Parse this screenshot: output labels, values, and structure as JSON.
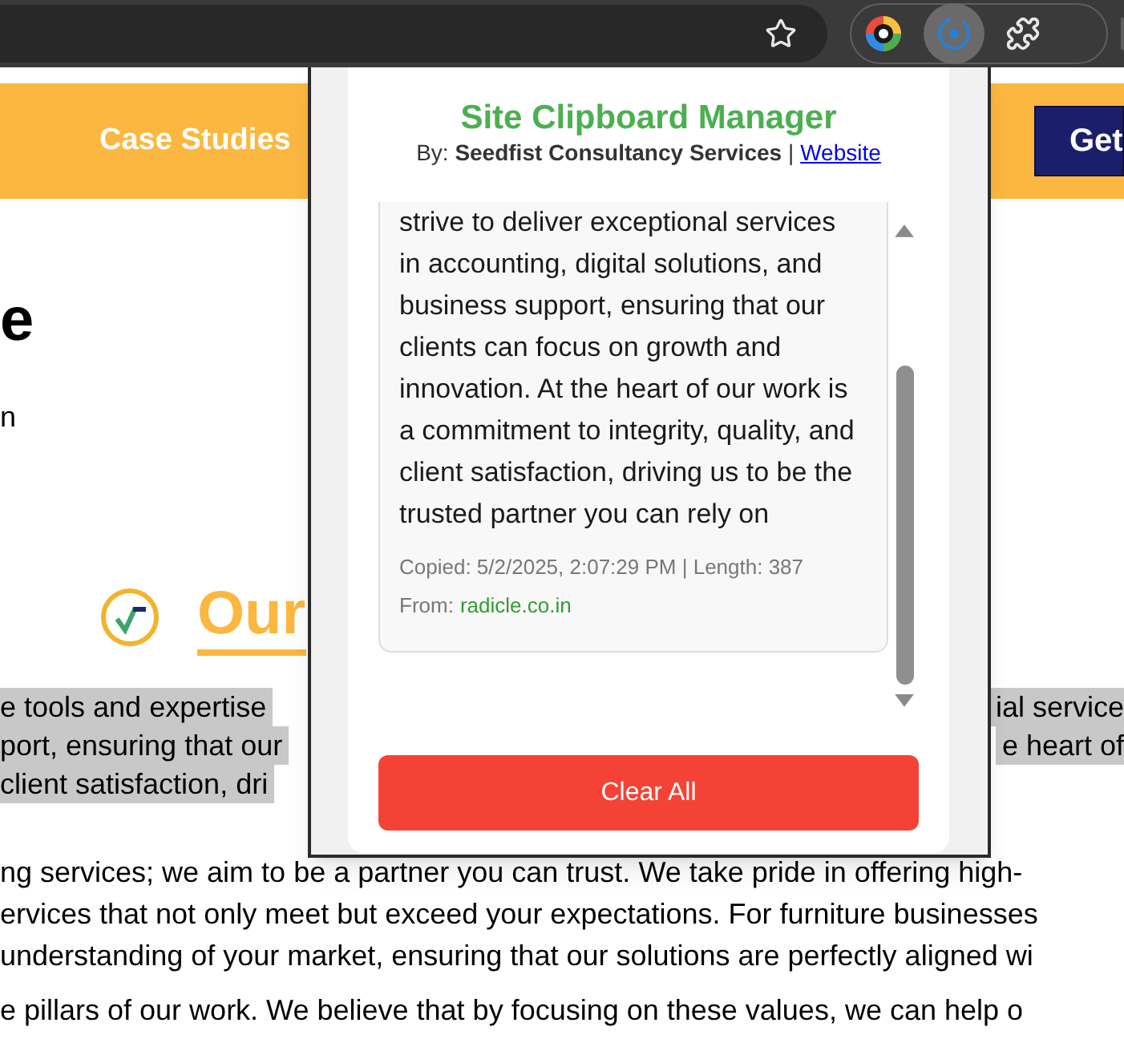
{
  "page": {
    "nav": {
      "links": [
        "Case Studies"
      ],
      "cta": "Get"
    },
    "heading": "e",
    "subtext": "n",
    "section_title": "Our",
    "text_lines": [
      {
        "left": "e tools and expertise",
        "right": "ial service",
        "highlighted": true
      },
      {
        "left": "port, ensuring that our",
        "right": "e heart of",
        "highlighted": true
      },
      {
        "left": "client satisfaction, dri",
        "highlighted": true
      },
      {
        "left": "ng services; we aim to be a partner you can trust. We take pride in offering high-",
        "highlighted": false
      },
      {
        "left": "ervices that not only meet but exceed your expectations. For furniture businesses",
        "highlighted": false
      },
      {
        "left": "understanding of your market, ensuring that our solutions are perfectly aligned wi",
        "highlighted": false
      },
      {
        "left": "e pillars of our work. We believe that by focusing on these values, we can help o",
        "highlighted": false
      }
    ]
  },
  "popup": {
    "title": "Site Clipboard Manager",
    "byline": "By: **Seedfist Consultancy Services** |",
    "website_link": "Website",
    "entries": [
      {
        "text": "strive to deliver exceptional services in accounting, digital solutions, and business support, ensuring that our clients can focus on growth and innovation. At the heart of our work is a commitment to integrity, quality, and client satisfaction, driving us to be the trusted partner you can rely on",
        "meta": "Copied: 5/2/2025, 2:07:29 PM | Length: 387",
        "from_label": "From:",
        "source": "radicle.co.in"
      }
    ],
    "clear_button": "Clear All"
  }
}
